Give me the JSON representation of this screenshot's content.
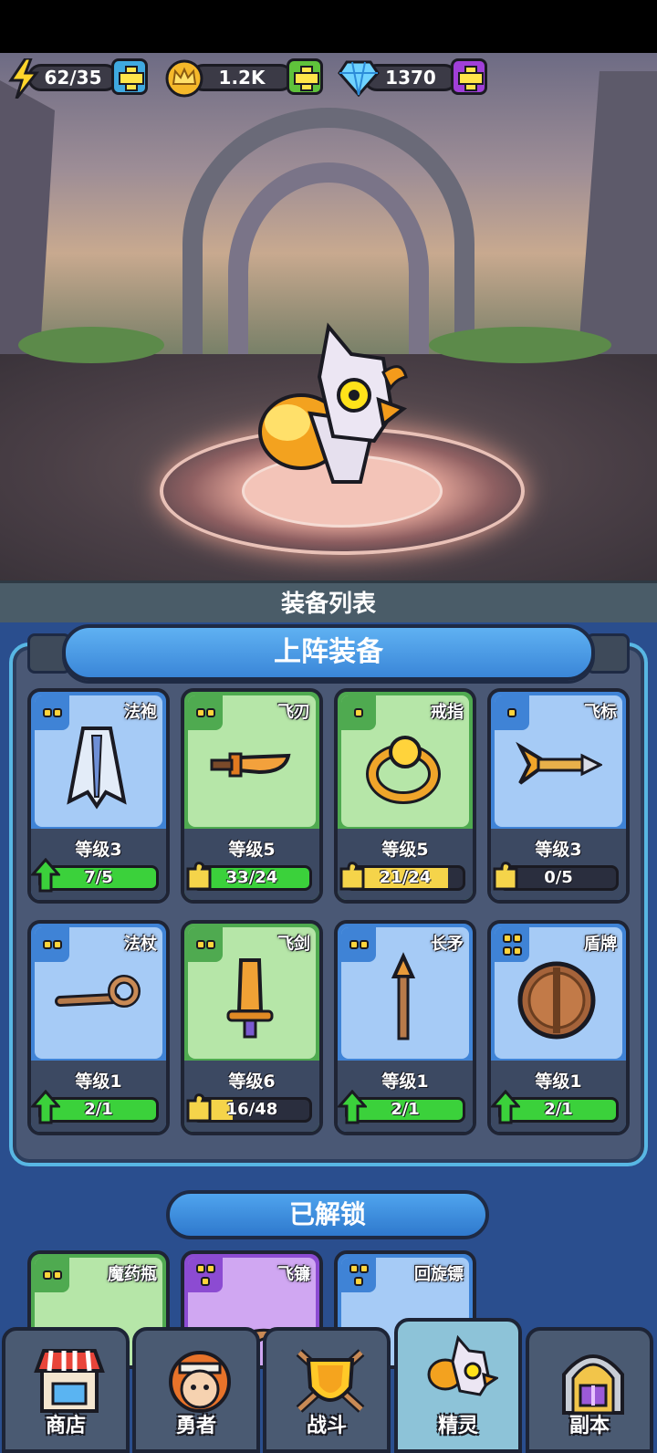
{
  "resources": {
    "energy": {
      "value": "62/35",
      "icon": "lightning-icon",
      "button_color": "#3fa9e0"
    },
    "gold": {
      "value": "1.2K",
      "icon": "crown-coin-icon",
      "button_color": "#5fc23b"
    },
    "gems": {
      "value": "1370",
      "icon": "diamond-icon",
      "button_color": "#a03fd8"
    }
  },
  "panel": {
    "title": "装备列表",
    "equipped_title": "上阵装备",
    "unlocked_title": "已解锁"
  },
  "equipped": [
    {
      "name": "法袍",
      "level": "等级3",
      "progress": "7/5",
      "fill": 1.0,
      "rarity_dots": 2,
      "color": "blue",
      "status": "upgrade",
      "icon": "robe-icon"
    },
    {
      "name": "飞刃",
      "level": "等级5",
      "progress": "33/24",
      "fill": 1.0,
      "rarity_dots": 2,
      "color": "green",
      "status": "shard",
      "icon": "blade-icon"
    },
    {
      "name": "戒指",
      "level": "等级5",
      "progress": "21/24",
      "fill": 0.875,
      "rarity_dots": 1,
      "color": "green",
      "status": "shard",
      "icon": "ring-icon"
    },
    {
      "name": "飞标",
      "level": "等级3",
      "progress": "0/5",
      "fill": 0.0,
      "rarity_dots": 1,
      "color": "blue",
      "status": "shard",
      "icon": "dart-icon"
    },
    {
      "name": "法杖",
      "level": "等级1",
      "progress": "2/1",
      "fill": 1.0,
      "rarity_dots": 2,
      "color": "blue",
      "status": "upgrade",
      "icon": "staff-icon"
    },
    {
      "name": "飞剑",
      "level": "等级6",
      "progress": "16/48",
      "fill": 0.33,
      "rarity_dots": 2,
      "color": "green",
      "status": "shard",
      "icon": "sword-icon"
    },
    {
      "name": "长矛",
      "level": "等级1",
      "progress": "2/1",
      "fill": 1.0,
      "rarity_dots": 2,
      "color": "blue",
      "status": "upgrade",
      "icon": "spear-icon"
    },
    {
      "name": "盾牌",
      "level": "等级1",
      "progress": "2/1",
      "fill": 1.0,
      "rarity_dots": 4,
      "color": "blue",
      "status": "upgrade",
      "icon": "shield-icon"
    }
  ],
  "unlocked": [
    {
      "name": "魔药瓶",
      "rarity_dots": 2,
      "color": "green",
      "icon": "potion-icon"
    },
    {
      "name": "飞镰",
      "rarity_dots": 3,
      "color": "purple",
      "icon": "sickle-icon"
    },
    {
      "name": "回旋镖",
      "rarity_dots": 3,
      "color": "blue",
      "icon": "boomerang-icon"
    }
  ],
  "nav": [
    {
      "label": "商店",
      "icon": "shop-icon",
      "active": false
    },
    {
      "label": "勇者",
      "icon": "hero-icon",
      "active": false
    },
    {
      "label": "战斗",
      "icon": "battle-icon",
      "active": false
    },
    {
      "label": "精灵",
      "icon": "spirit-icon",
      "active": true
    },
    {
      "label": "副本",
      "icon": "dungeon-icon",
      "active": false
    }
  ]
}
